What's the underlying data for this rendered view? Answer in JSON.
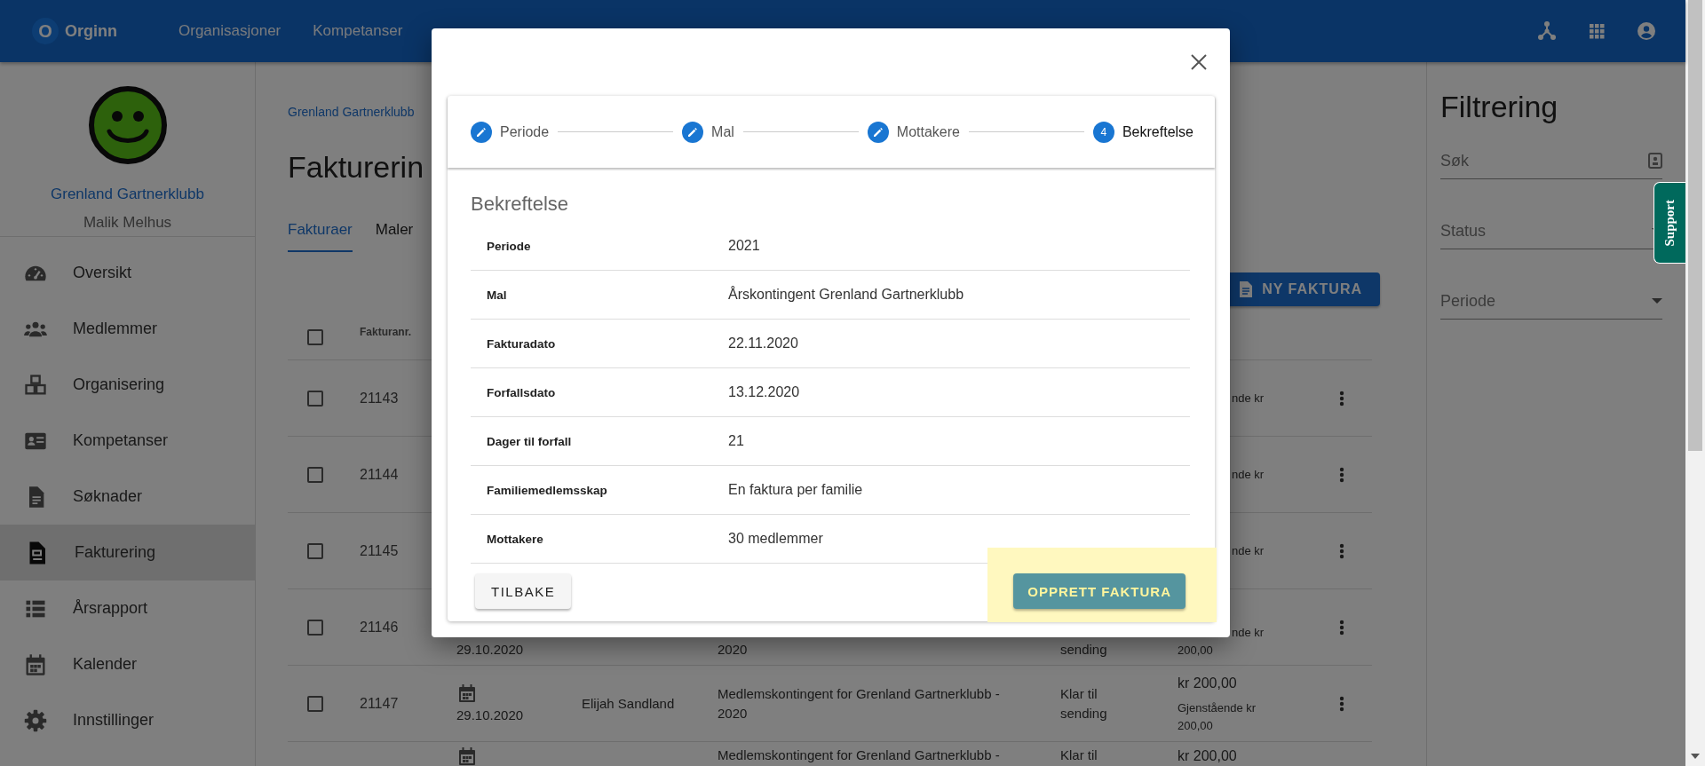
{
  "topbar": {
    "logo_letter": "O",
    "brand": "Orginn",
    "nav": [
      {
        "label": "Organisasjoner"
      },
      {
        "label": "Kompetanser"
      }
    ]
  },
  "sidebar": {
    "org_name": "Grenland Gartnerklubb",
    "user_name": "Malik Melhus",
    "items": [
      {
        "label": "Oversikt",
        "selected": false
      },
      {
        "label": "Medlemmer",
        "selected": false
      },
      {
        "label": "Organisering",
        "selected": false
      },
      {
        "label": "Kompetanser",
        "selected": false
      },
      {
        "label": "Søknader",
        "selected": false
      },
      {
        "label": "Fakturering",
        "selected": true
      },
      {
        "label": "Årsrapport",
        "selected": false
      },
      {
        "label": "Kalender",
        "selected": false
      },
      {
        "label": "Innstillinger",
        "selected": false
      }
    ]
  },
  "main": {
    "breadcrumb": "Grenland Gartnerklubb",
    "title": "Fakturerin",
    "tabs": [
      {
        "label": "Fakturaer",
        "selected": true
      },
      {
        "label": "Maler",
        "selected": false
      }
    ],
    "new_button": "NY FAKTURA",
    "table": {
      "header": {
        "checked": false,
        "columns": [
          {
            "label": "Fakturanr."
          }
        ]
      },
      "rows": [
        {
          "checked": false,
          "number": "21143",
          "amount_tail": "nde kr"
        },
        {
          "checked": false,
          "number": "21144",
          "amount_tail": "nde kr"
        },
        {
          "checked": false,
          "number": "21145",
          "amount_tail": "nde kr"
        },
        {
          "checked": false,
          "number": "21146",
          "date": "29.10.2020",
          "description": "2020",
          "status": "sending",
          "amount_tail": "nde kr",
          "remaining": "200,00"
        },
        {
          "checked": false,
          "number": "21147",
          "date": "29.10.2020",
          "name": "Elijah Sandland",
          "description": "Medlemskontingent for Grenland Gartnerklubb - 2020",
          "status": "Klar til sending",
          "amount": "kr 200,00",
          "remaining": "Gjenstående kr 200,00"
        },
        {
          "description": "Medlemskontingent for Grenland Gartnerklubb -",
          "status": "Klar til",
          "amount": "kr 200,00"
        }
      ]
    }
  },
  "filters": {
    "title": "Filtrering",
    "fields": [
      {
        "kind": "search",
        "placeholder": "Søk"
      },
      {
        "kind": "select",
        "label": "Status"
      },
      {
        "kind": "select",
        "label": "Periode"
      }
    ]
  },
  "support_tab": {
    "label": "Support"
  },
  "dialog": {
    "steps": [
      {
        "label": "Periode",
        "completed": true,
        "selected": false
      },
      {
        "label": "Mal",
        "completed": true,
        "selected": false
      },
      {
        "label": "Mottakere",
        "completed": true,
        "selected": false
      },
      {
        "label": "Bekreftelse",
        "number": "4",
        "completed": false,
        "selected": true
      }
    ],
    "heading": "Bekreftelse",
    "summary": [
      {
        "label": "Periode",
        "value": "2021"
      },
      {
        "label": "Mal",
        "value": "Årskontingent Grenland Gartnerklubb"
      },
      {
        "label": "Fakturadato",
        "value": "22.11.2020"
      },
      {
        "label": "Forfallsdato",
        "value": "13.12.2020"
      },
      {
        "label": "Dager til forfall",
        "value": "21"
      },
      {
        "label": "Familiemedlemsskap",
        "value": "En faktura per familie"
      },
      {
        "label": "Mottakere",
        "value": "30 medlemmer"
      }
    ],
    "back_button": "TILBAKE",
    "submit_button": "OPPRETT FAKTURA",
    "highlighted": true
  }
}
